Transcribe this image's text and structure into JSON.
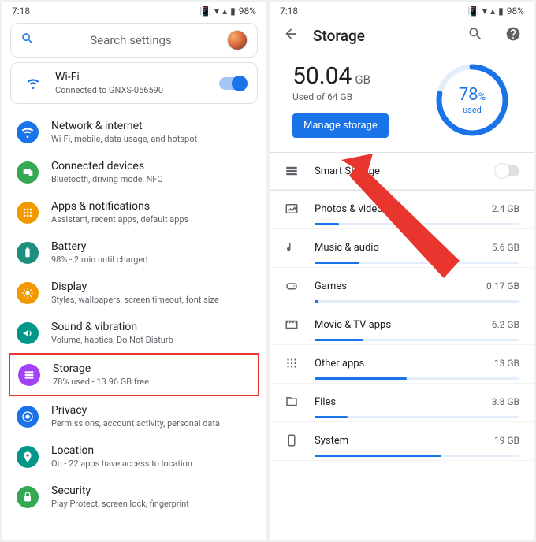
{
  "statusbar": {
    "time": "7:18",
    "battery": "98%"
  },
  "left": {
    "search_placeholder": "Search settings",
    "wifi": {
      "title": "Wi-Fi",
      "subtitle": "Connected to GNXS-056590"
    },
    "items": [
      {
        "title": "Network & internet",
        "subtitle": "Wi-Fi, mobile, data usage, and hotspot",
        "color": "#1a73e8",
        "icon": "wifi"
      },
      {
        "title": "Connected devices",
        "subtitle": "Bluetooth, driving mode, NFC",
        "color": "#34a853",
        "icon": "devices"
      },
      {
        "title": "Apps & notifications",
        "subtitle": "Assistant, recent apps, default apps",
        "color": "#f29900",
        "icon": "apps"
      },
      {
        "title": "Battery",
        "subtitle": "98% - 2 min until charged",
        "color": "#1e8e7e",
        "icon": "battery"
      },
      {
        "title": "Display",
        "subtitle": "Styles, wallpapers, screen timeout, font size",
        "color": "#f29900",
        "icon": "display"
      },
      {
        "title": "Sound & vibration",
        "subtitle": "Volume, haptics, Do Not Disturb",
        "color": "#009688",
        "icon": "sound"
      },
      {
        "title": "Storage",
        "subtitle": "78% used - 13.96 GB free",
        "color": "#a142f4",
        "icon": "storage",
        "highlight": true
      },
      {
        "title": "Privacy",
        "subtitle": "Permissions, account activity, personal data",
        "color": "#1a73e8",
        "icon": "privacy"
      },
      {
        "title": "Location",
        "subtitle": "On - 22 apps have access to location",
        "color": "#009688",
        "icon": "location"
      },
      {
        "title": "Security",
        "subtitle": "Play Protect, screen lock, fingerprint",
        "color": "#34a853",
        "icon": "security"
      }
    ]
  },
  "right": {
    "title": "Storage",
    "used_value": "50.04",
    "used_unit": "GB",
    "used_caption": "Used of 64 GB",
    "manage_label": "Manage storage",
    "ring_percent": "78",
    "ring_pct_sym": "%",
    "ring_caption": "used",
    "smart_label": "Smart Storage",
    "categories": [
      {
        "label": "Photos & videos",
        "value": "2.4 GB",
        "fill": 12,
        "icon": "photos"
      },
      {
        "label": "Music & audio",
        "value": "5.6 GB",
        "fill": 22,
        "icon": "music"
      },
      {
        "label": "Games",
        "value": "0.17 GB",
        "fill": 2,
        "icon": "games"
      },
      {
        "label": "Movie & TV apps",
        "value": "6.2 GB",
        "fill": 24,
        "icon": "movie"
      },
      {
        "label": "Other apps",
        "value": "13 GB",
        "fill": 45,
        "icon": "other"
      },
      {
        "label": "Files",
        "value": "3.8 GB",
        "fill": 16,
        "icon": "files"
      },
      {
        "label": "System",
        "value": "19 GB",
        "fill": 62,
        "icon": "system"
      }
    ]
  }
}
